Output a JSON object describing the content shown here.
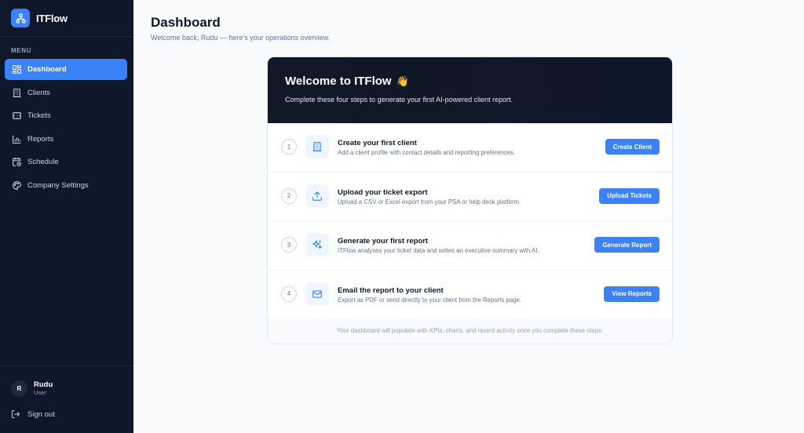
{
  "brand": {
    "name": "ITFlow"
  },
  "sidebar": {
    "menu_label": "MENU",
    "items": [
      {
        "label": "Dashboard",
        "icon": "grid-icon"
      },
      {
        "label": "Clients",
        "icon": "building-icon"
      },
      {
        "label": "Tickets",
        "icon": "ticket-icon"
      },
      {
        "label": "Reports",
        "icon": "bar-chart-icon"
      },
      {
        "label": "Schedule",
        "icon": "calendar-clock-icon"
      },
      {
        "label": "Company Settings",
        "icon": "palette-icon"
      }
    ],
    "user": {
      "initial": "R",
      "name": "Rudu",
      "role": "User"
    },
    "signout_label": "Sign out"
  },
  "header": {
    "title": "Dashboard",
    "subtitle": "Welcome back, Rudu — here's your operations overview."
  },
  "welcome": {
    "title": "Welcome to ITFlow",
    "emoji": "👋",
    "subtitle": "Complete these four steps to generate your first AI-powered client report.",
    "steps": [
      {
        "num": "1",
        "title": "Create your first client",
        "desc": "Add a client profile with contact details and reporting preferences.",
        "button": "Create Client",
        "icon": "building-icon"
      },
      {
        "num": "2",
        "title": "Upload your ticket export",
        "desc": "Upload a CSV or Excel export from your PSA or help desk platform.",
        "button": "Upload Tickets",
        "icon": "upload-icon"
      },
      {
        "num": "3",
        "title": "Generate your first report",
        "desc": "ITFlow analyses your ticket data and writes an executive summary with AI.",
        "button": "Generate Report",
        "icon": "sparkles-icon"
      },
      {
        "num": "4",
        "title": "Email the report to your client",
        "desc": "Export as PDF or send directly to your client from the Reports page.",
        "button": "View Reports",
        "icon": "mail-icon"
      }
    ],
    "footer": "Your dashboard will populate with KPIs, charts, and recent activity once you complete these steps."
  },
  "colors": {
    "accent": "#3b82f6",
    "sidebar_bg": "#0f172a",
    "page_bg": "#f8fafc"
  }
}
